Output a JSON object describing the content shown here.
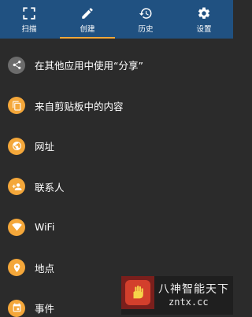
{
  "tabs": [
    {
      "label": "扫描",
      "icon": "scan-icon"
    },
    {
      "label": "创建",
      "icon": "pencil-icon",
      "active": true
    },
    {
      "label": "历史",
      "icon": "history-icon"
    },
    {
      "label": "设置",
      "icon": "gear-icon"
    }
  ],
  "menu": {
    "items": [
      {
        "label": "在其他应用中使用“分享”",
        "icon": "share-icon"
      },
      {
        "label": "来自剪贴板中的内容",
        "icon": "clipboard-icon"
      },
      {
        "label": "网址",
        "icon": "globe-icon"
      },
      {
        "label": "联系人",
        "icon": "add-contact-icon"
      },
      {
        "label": "WiFi",
        "icon": "wifi-icon"
      },
      {
        "label": "地点",
        "icon": "location-pin-icon"
      },
      {
        "label": "事件",
        "icon": "calendar-icon"
      }
    ]
  },
  "watermark": {
    "title": "八神智能天下",
    "subtitle": "zntx.cc"
  },
  "colors": {
    "tabbar": "#205181",
    "accent": "#f4a73a",
    "background": "#2b2b2b",
    "share_icon_bg": "#6c6c6c"
  }
}
